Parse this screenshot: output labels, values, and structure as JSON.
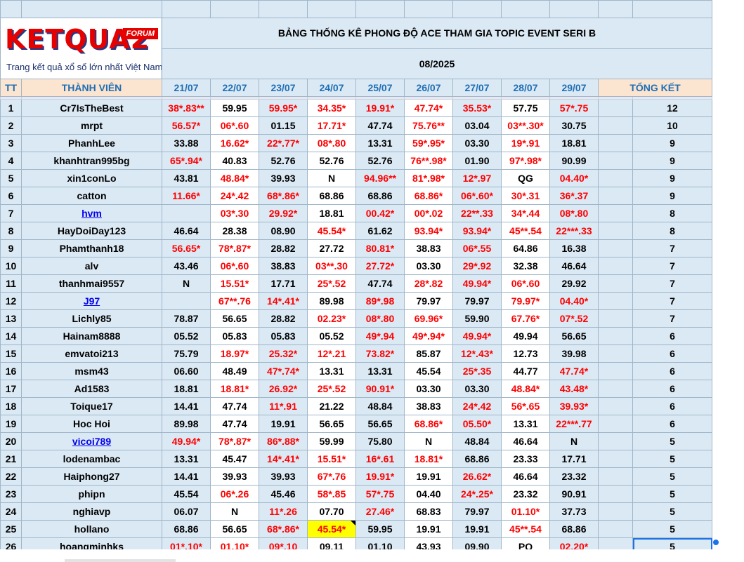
{
  "logo": {
    "word": "KETQUA2",
    "badge": "FORUM",
    "tagline": "Trang kết quả xổ số lớn nhất Việt Nam"
  },
  "title": "BẢNG THỐNG KÊ PHONG ĐỘ ACE THAM GIA TOPIC EVENT SERI B",
  "month": "08/2025",
  "headers": {
    "tt": "TT",
    "member": "THÀNH VIÊN",
    "total": "TỔNG KẾT"
  },
  "dates": [
    "21/07",
    "22/07",
    "23/07",
    "24/07",
    "25/07",
    "26/07",
    "27/07",
    "28/07",
    "29/07"
  ],
  "rows": [
    {
      "tt": "1",
      "name": "Cr7IsTheBest",
      "link": false,
      "vals": [
        "38*.83**",
        "59.95",
        "59.95*",
        "34.35*",
        "19.91*",
        "47.74*",
        "35.53*",
        "57.75",
        "57*.75"
      ],
      "red": [
        1,
        0,
        1,
        1,
        1,
        1,
        1,
        0,
        1
      ],
      "total": "12"
    },
    {
      "tt": "2",
      "name": "mrpt",
      "link": false,
      "vals": [
        "56.57*",
        "06*.60",
        "01.15",
        "17.71*",
        "47.74",
        "75.76**",
        "03.04",
        "03**.30*",
        "30.75"
      ],
      "red": [
        1,
        1,
        0,
        1,
        0,
        1,
        0,
        1,
        0
      ],
      "total": "10"
    },
    {
      "tt": "3",
      "name": "PhanhLee",
      "link": false,
      "vals": [
        "33.88",
        "16.62*",
        "22*.77*",
        "08*.80",
        "13.31",
        "59*.95*",
        "03.30",
        "19*.91",
        "18.81"
      ],
      "red": [
        0,
        1,
        1,
        1,
        0,
        1,
        0,
        1,
        0
      ],
      "total": "9"
    },
    {
      "tt": "4",
      "name": "khanhtran995bg",
      "link": false,
      "vals": [
        "65*.94*",
        "40.83",
        "52.76",
        "52.76",
        "52.76",
        "76**.98*",
        "01.90",
        "97*.98*",
        "90.99"
      ],
      "red": [
        1,
        0,
        0,
        0,
        0,
        1,
        0,
        1,
        0
      ],
      "total": "9"
    },
    {
      "tt": "5",
      "name": "xin1conLo",
      "link": false,
      "vals": [
        "43.81",
        "48.84*",
        "39.93",
        "N",
        "94.96**",
        "81*.98*",
        "12*.97",
        "QG",
        "04.40*"
      ],
      "red": [
        0,
        1,
        0,
        0,
        1,
        1,
        1,
        0,
        1
      ],
      "total": "9"
    },
    {
      "tt": "6",
      "name": "catton",
      "link": false,
      "vals": [
        "11.66*",
        "24*.42",
        "68*.86*",
        "68.86",
        "68.86",
        "68.86*",
        "06*.60*",
        "30*.31",
        "36*.37"
      ],
      "red": [
        1,
        1,
        1,
        0,
        0,
        1,
        1,
        1,
        1
      ],
      "total": "9"
    },
    {
      "tt": "7",
      "name": "hvm",
      "link": true,
      "vals": [
        "",
        "03*.30",
        "29.92*",
        "18.81",
        "00.42*",
        "00*.02",
        "22**.33",
        "34*.44",
        "08*.80"
      ],
      "red": [
        0,
        1,
        1,
        0,
        1,
        1,
        1,
        1,
        1
      ],
      "total": "8"
    },
    {
      "tt": "8",
      "name": "HayDoiDay123",
      "link": false,
      "vals": [
        "46.64",
        "28.38",
        "08.90",
        "45.54*",
        "61.62",
        "93.94*",
        "93.94*",
        "45**.54",
        "22***.33"
      ],
      "red": [
        0,
        0,
        0,
        1,
        0,
        1,
        1,
        1,
        1
      ],
      "total": "8"
    },
    {
      "tt": "9",
      "name": "Phamthanh18",
      "link": false,
      "vals": [
        "56.65*",
        "78*.87*",
        "28.82",
        "27.72",
        "80.81*",
        "38.83",
        "06*.55",
        "64.86",
        "16.38"
      ],
      "red": [
        1,
        1,
        0,
        0,
        1,
        0,
        1,
        0,
        0
      ],
      "total": "7"
    },
    {
      "tt": "10",
      "name": "alv",
      "link": false,
      "vals": [
        "43.46",
        "06*.60",
        "38.83",
        "03**.30",
        "27.72*",
        "03.30",
        "29*.92",
        "32.38",
        "46.64"
      ],
      "red": [
        0,
        1,
        0,
        1,
        1,
        0,
        1,
        0,
        0
      ],
      "total": "7"
    },
    {
      "tt": "11",
      "name": "thanhmai9557",
      "link": false,
      "vals": [
        "N",
        "15.51*",
        "17.71",
        "25*.52",
        "47.74",
        "28*.82",
        "49.94*",
        "06*.60",
        "29.92"
      ],
      "red": [
        0,
        1,
        0,
        1,
        0,
        1,
        1,
        1,
        0
      ],
      "total": "7"
    },
    {
      "tt": "12",
      "name": "J97",
      "link": true,
      "vals": [
        "",
        "67**.76",
        "14*.41*",
        "89.98",
        "89*.98",
        "79.97",
        "79.97",
        "79.97*",
        "04.40*"
      ],
      "red": [
        0,
        1,
        1,
        0,
        1,
        0,
        0,
        1,
        1
      ],
      "total": "7"
    },
    {
      "tt": "13",
      "name": "Lichly85",
      "link": false,
      "vals": [
        "78.87",
        "56.65",
        "28.82",
        "02.23*",
        "08*.80",
        "69.96*",
        "59.90",
        "67.76*",
        "07*.52"
      ],
      "red": [
        0,
        0,
        0,
        1,
        1,
        1,
        0,
        1,
        1
      ],
      "total": "7"
    },
    {
      "tt": "14",
      "name": "Hainam8888",
      "link": false,
      "vals": [
        "05.52",
        "05.83",
        "05.83",
        "05.52",
        "49*.94",
        "49*.94*",
        "49.94*",
        "49.94",
        "56.65"
      ],
      "red": [
        0,
        0,
        0,
        0,
        1,
        1,
        1,
        0,
        0
      ],
      "total": "6"
    },
    {
      "tt": "15",
      "name": "emvatoi213",
      "link": false,
      "vals": [
        "75.79",
        "18.97*",
        "25.32*",
        "12*.21",
        "73.82*",
        "85.87",
        "12*.43*",
        "12.73",
        "39.98"
      ],
      "red": [
        0,
        1,
        1,
        1,
        1,
        0,
        1,
        0,
        0
      ],
      "total": "6"
    },
    {
      "tt": "16",
      "name": "msm43",
      "link": false,
      "vals": [
        "06.60",
        "48.49",
        "47*.74*",
        "13.31",
        "13.31",
        "45.54",
        "25*.35",
        "44.77",
        "47.74*"
      ],
      "red": [
        0,
        0,
        1,
        0,
        0,
        0,
        1,
        0,
        1
      ],
      "total": "6"
    },
    {
      "tt": "17",
      "name": "Ad1583",
      "link": false,
      "vals": [
        "18.81",
        "18.81*",
        "26.92*",
        "25*.52",
        "90.91*",
        "03.30",
        "03.30",
        "48.84*",
        "43.48*"
      ],
      "red": [
        0,
        1,
        1,
        1,
        1,
        0,
        0,
        1,
        1
      ],
      "total": "6"
    },
    {
      "tt": "18",
      "name": "Toique17",
      "link": false,
      "vals": [
        "14.41",
        "47.74",
        "11*.91",
        "21.22",
        "48.84",
        "38.83",
        "24*.42",
        "56*.65",
        "39.93*"
      ],
      "red": [
        0,
        0,
        1,
        0,
        0,
        0,
        1,
        1,
        1
      ],
      "total": "6"
    },
    {
      "tt": "19",
      "name": "Hoc Hoi",
      "link": false,
      "vals": [
        "89.98",
        "47.74",
        "19.91",
        "56.65",
        "56.65",
        "68.86*",
        "05.50*",
        "13.31",
        "22***.77"
      ],
      "red": [
        0,
        0,
        0,
        0,
        0,
        1,
        1,
        0,
        1
      ],
      "total": "6"
    },
    {
      "tt": "20",
      "name": "vicoi789",
      "link": true,
      "vals": [
        "49.94*",
        "78*.87*",
        "86*.88*",
        "59.99",
        "75.80",
        "N",
        "48.84",
        "46.64",
        "N"
      ],
      "red": [
        1,
        1,
        1,
        0,
        0,
        0,
        0,
        0,
        0
      ],
      "total": "5"
    },
    {
      "tt": "21",
      "name": "lodenambac",
      "link": false,
      "vals": [
        "13.31",
        "45.47",
        "14*.41*",
        "15.51*",
        "16*.61",
        "18.81*",
        "68.86",
        "23.33",
        "17.71"
      ],
      "red": [
        0,
        0,
        1,
        1,
        1,
        1,
        0,
        0,
        0
      ],
      "total": "5"
    },
    {
      "tt": "22",
      "name": "Haiphong27",
      "link": false,
      "vals": [
        "14.41",
        "39.93",
        "39.93",
        "67*.76",
        "19.91*",
        "19.91",
        "26.62*",
        "46.64",
        "23.32"
      ],
      "red": [
        0,
        0,
        0,
        1,
        1,
        0,
        1,
        0,
        0
      ],
      "total": "5"
    },
    {
      "tt": "23",
      "name": "phipn",
      "link": false,
      "vals": [
        "45.54",
        "06*.26",
        "45.46",
        "58*.85",
        "57*.75",
        "04.40",
        "24*.25*",
        "23.32",
        "90.91"
      ],
      "red": [
        0,
        1,
        0,
        1,
        1,
        0,
        1,
        0,
        0
      ],
      "total": "5"
    },
    {
      "tt": "24",
      "name": "nghiavp",
      "link": false,
      "vals": [
        "06.07",
        "N",
        "11*.26",
        "07.70",
        "27.46*",
        "68.83",
        "79.97",
        "01.10*",
        "37.73"
      ],
      "red": [
        0,
        0,
        1,
        0,
        1,
        0,
        0,
        1,
        0
      ],
      "total": "5"
    },
    {
      "tt": "25",
      "name": "hollano",
      "link": false,
      "vals": [
        "68.86",
        "56.65",
        "68*.86*",
        "45.54*",
        "59.95",
        "19.91",
        "19.91",
        "45**.54",
        "68.86"
      ],
      "red": [
        0,
        0,
        1,
        1,
        0,
        0,
        0,
        1,
        0
      ],
      "total": "5"
    },
    {
      "tt": "26",
      "name": "hoangminhks",
      "link": false,
      "vals": [
        "01*.10*",
        "01.10*",
        "09*.10",
        "09.11",
        "01.10",
        "43.93",
        "09.90",
        "PQ",
        "02.20*"
      ],
      "red": [
        1,
        1,
        1,
        0,
        0,
        0,
        0,
        0,
        1
      ],
      "total": "5"
    }
  ]
}
